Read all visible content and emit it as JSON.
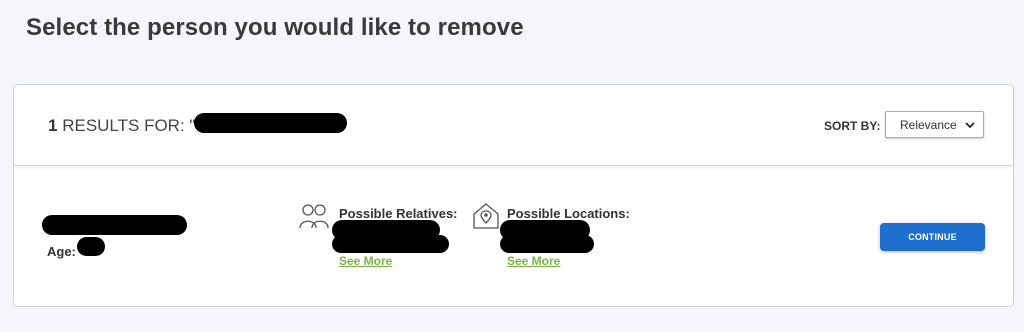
{
  "page": {
    "title": "Select the person you would like to remove"
  },
  "results": {
    "count": "1",
    "label": "RESULTS FOR:",
    "quote": "\""
  },
  "sort": {
    "label": "SORT BY:",
    "selected": "Relevance"
  },
  "person": {
    "age_label": "Age:",
    "relatives_label": "Possible Relatives:",
    "relatives_see_more": "See More",
    "locations_label": "Possible Locations:",
    "locations_see_more": "See More"
  },
  "actions": {
    "continue_label": "CONTINUE"
  },
  "colors": {
    "accent": "#1f6fce",
    "link": "#7cb342",
    "background": "#f4f6fb"
  },
  "icons": [
    "people-icon",
    "location-pin-icon",
    "chevron-down-icon"
  ]
}
